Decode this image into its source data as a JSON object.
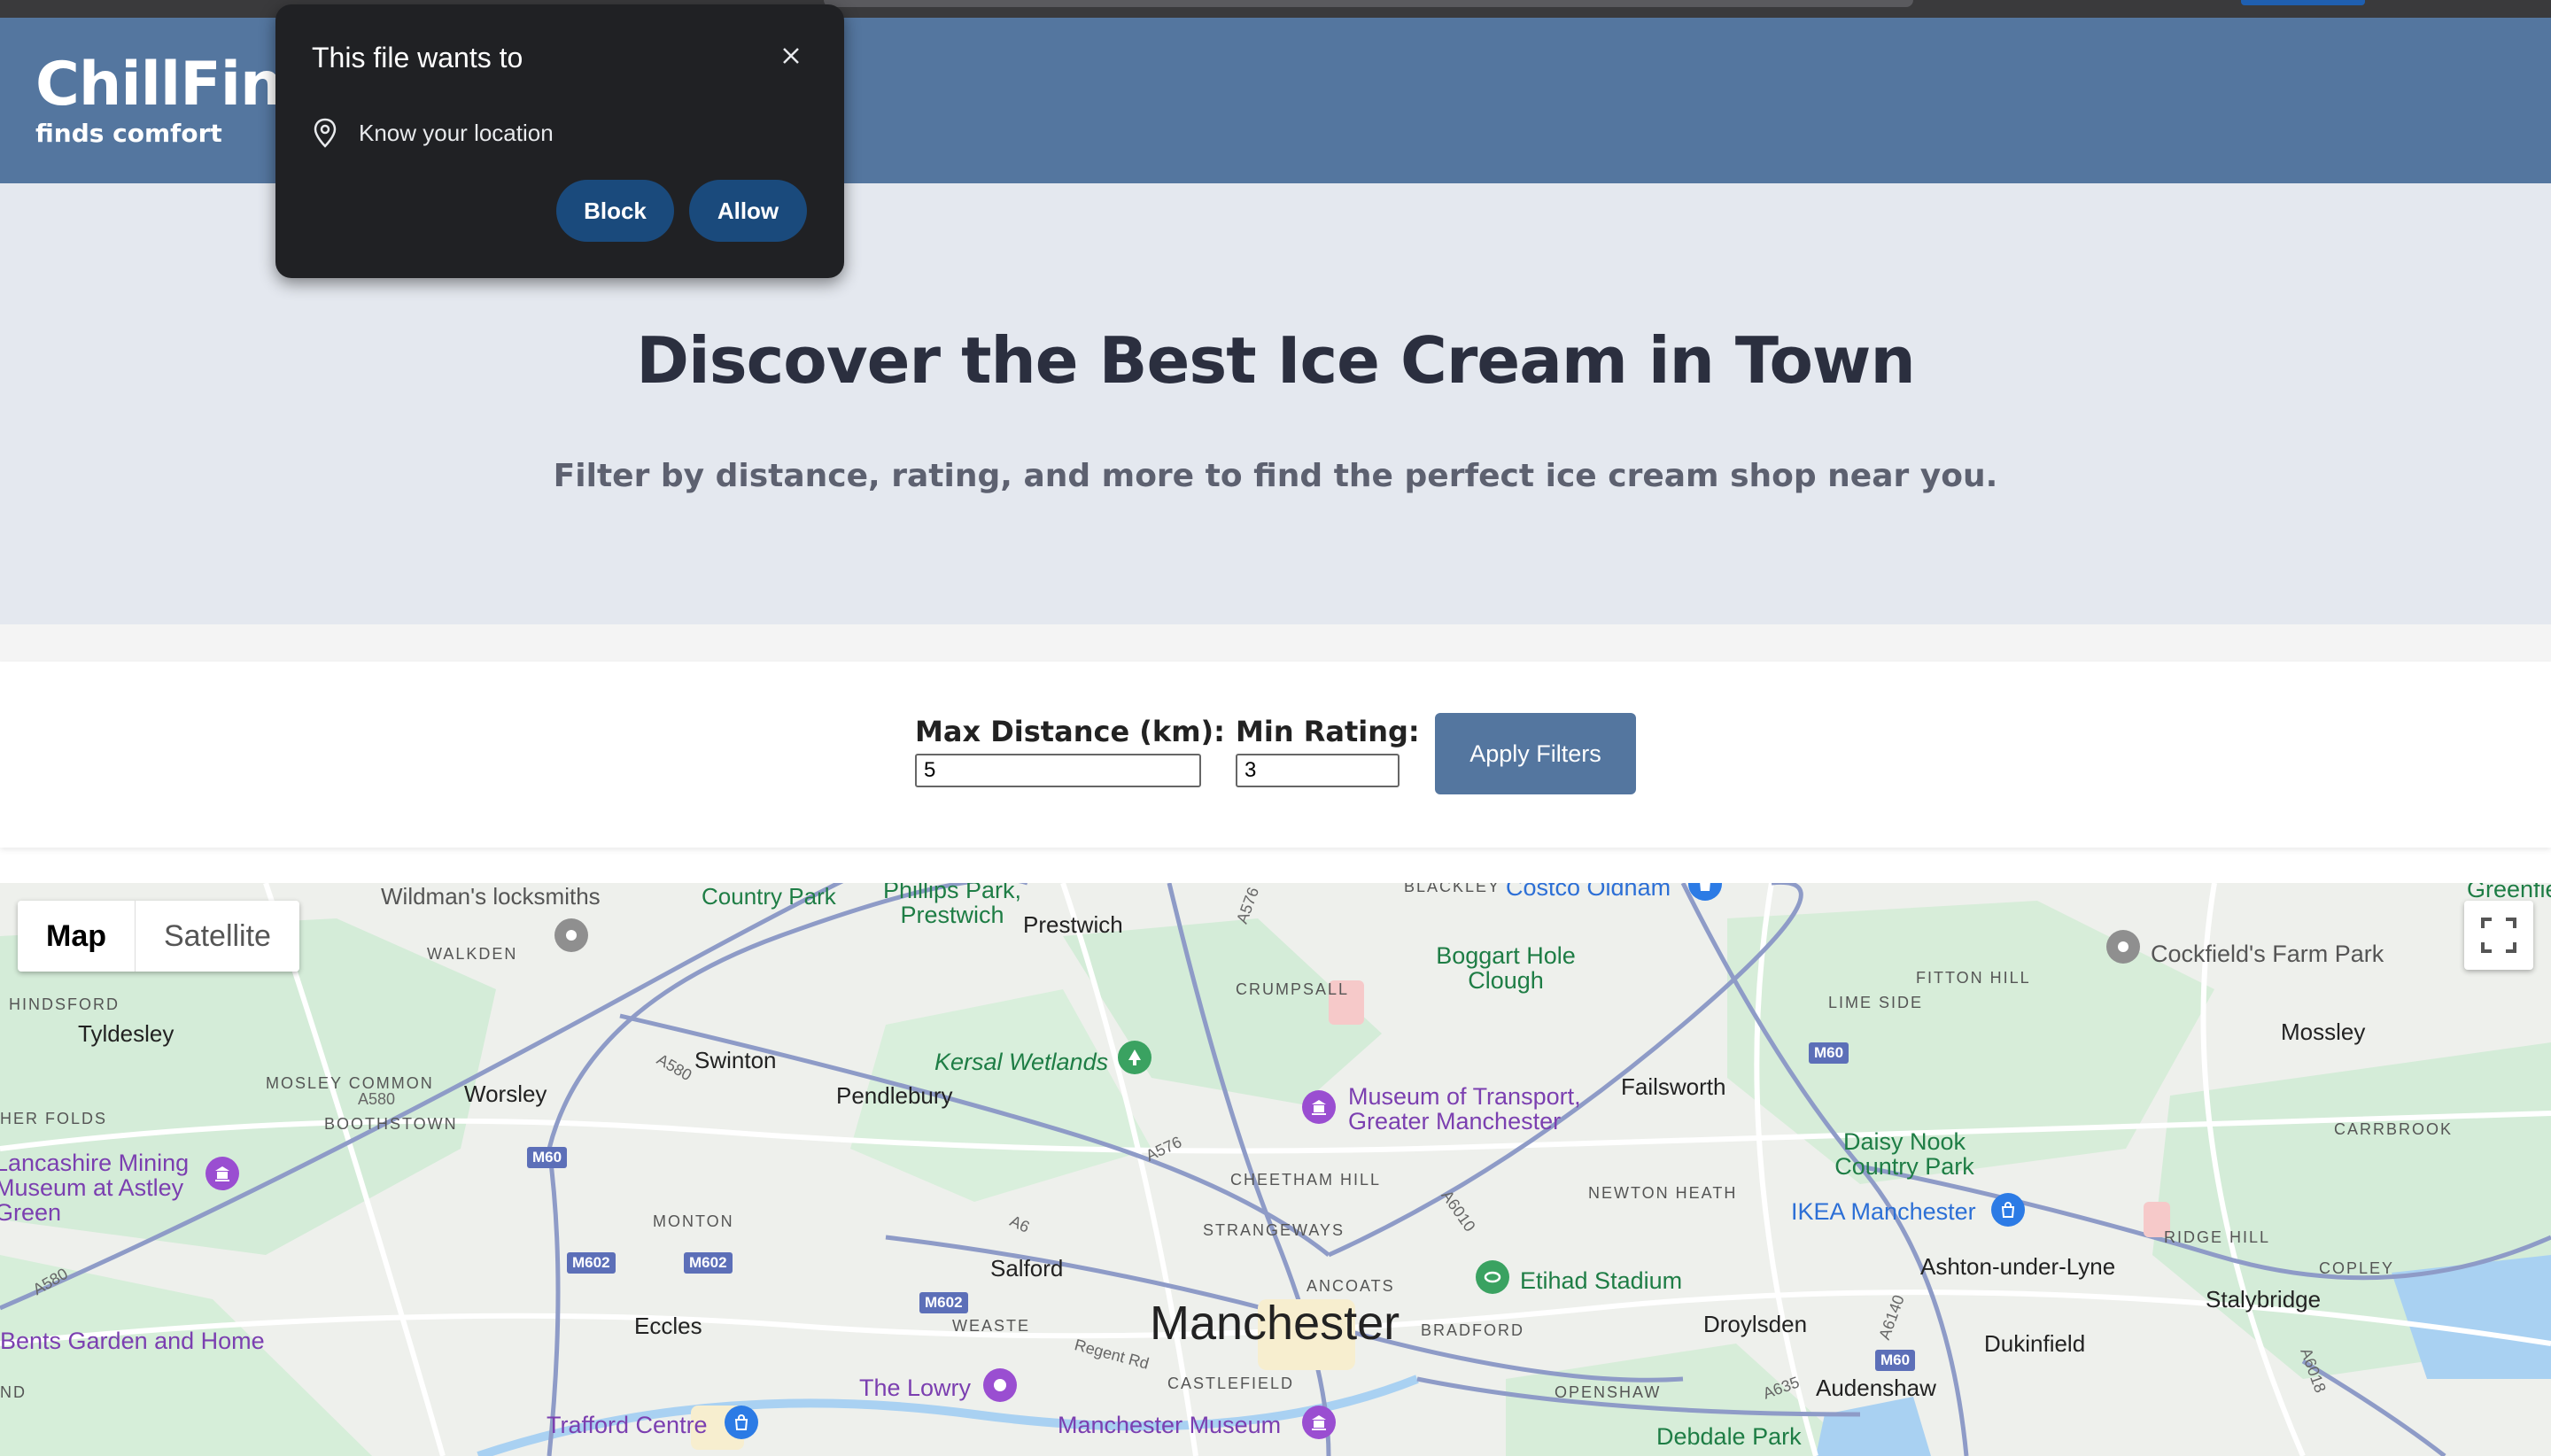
{
  "header": {
    "brand": "ChillFind",
    "tagline": "finds comfort"
  },
  "hero": {
    "title": "Discover the Best Ice Cream in Town",
    "subtitle": "Filter by distance, rating, and more to find the perfect ice cream shop near you."
  },
  "filters": {
    "max_distance_label": "Max Distance (km):",
    "max_distance_value": "5",
    "min_rating_label": "Min Rating:",
    "min_rating_value": "3",
    "apply_label": "Apply Filters"
  },
  "map": {
    "type_options": [
      "Map",
      "Satellite"
    ],
    "selected_type": "Map",
    "city": "Manchester",
    "towns": [
      "Tyldesley",
      "Worsley",
      "Swinton",
      "Pendlebury",
      "Prestwich",
      "Failsworth",
      "Mossley",
      "Salford",
      "Eccles",
      "Droylsden",
      "Ashton-under-Lyne",
      "Stalybridge",
      "Dukinfield",
      "Audenshaw"
    ],
    "districts": [
      "WALKDEN",
      "HINDSFORD",
      "MOSLEY COMMON",
      "BOOTHSTOWN",
      "HER FOLDS",
      "MONTON",
      "CRUMPSALL",
      "CHEETHAM HILL",
      "STRANGEWAYS",
      "ANCOATS",
      "BRADFORD",
      "WEASTE",
      "CASTLEFIELD",
      "OPENSHAW",
      "NEWTON HEATH",
      "FITTON HILL",
      "LIME SIDE",
      "CARRBROOK",
      "RIDGE HILL",
      "COPLEY",
      "BLACKLEY",
      "ND"
    ],
    "places": [
      "Wildman's locksmiths",
      "Country Park",
      "Phillips Park, Prestwich",
      "Boggart Hole Clough",
      "Cockfield's Farm Park",
      "Kersal Wetlands",
      "Museum of Transport, Greater Manchester",
      "Lancashire Mining Museum at Astley Green",
      "Daisy Nook Country Park",
      "IKEA Manchester",
      "Etihad Stadium",
      "Bents Garden and Home",
      "The Lowry",
      "Trafford Centre",
      "Manchester Museum",
      "Debdale Park",
      "Costco Oldham",
      "Greenfield"
    ],
    "roads": [
      "A580",
      "A576",
      "A6",
      "A6010",
      "A635",
      "A6140",
      "A6018",
      "Regent Rd",
      "M60",
      "M602"
    ]
  },
  "permission": {
    "title": "This file wants to",
    "request": "Know your location",
    "block_label": "Block",
    "allow_label": "Allow"
  },
  "colors": {
    "header_bg": "#54769f",
    "hero_bg": "#e4e8ef",
    "apply_bg": "#54769f",
    "dialog_bg": "#202124",
    "dialog_button_bg": "#1a4a7c"
  }
}
